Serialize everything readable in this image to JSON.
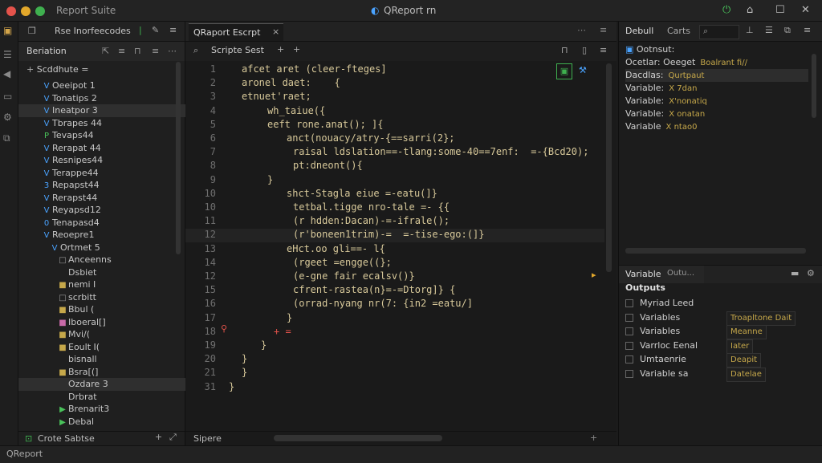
{
  "titlebar": {
    "app_name": "Report Suite",
    "window_title": "QReport rn",
    "dot_colors": [
      "#e5534b",
      "#e3a82b",
      "#3fb04f"
    ]
  },
  "sidebar": {
    "top_label": "Rse Inorfeecodes",
    "section_label": "Beriation",
    "tree_header": "Scddhute =",
    "items": [
      {
        "label": "Oeeipot 1",
        "icon": "V"
      },
      {
        "label": "Tonatips 2",
        "icon": "V"
      },
      {
        "label": "Ineatpor 3",
        "icon": "V"
      },
      {
        "label": "Tbrapes 44",
        "icon": "V"
      },
      {
        "label": "Tevaps44",
        "icon": "P"
      },
      {
        "label": "Rerapat 44",
        "icon": "V"
      },
      {
        "label": "Resnipes44",
        "icon": "V"
      },
      {
        "label": "Terappe44",
        "icon": "V"
      },
      {
        "label": "Repapst44",
        "icon": "3"
      },
      {
        "label": "Rerapst44",
        "icon": "V"
      },
      {
        "label": "Reyapsd12",
        "icon": "V"
      },
      {
        "label": "Tenapasd4",
        "icon": "0"
      },
      {
        "label": "Reoepre1",
        "icon": "V"
      },
      {
        "label": "Ortmet 5",
        "icon": "V"
      },
      {
        "label": "Anceenns",
        "icon": "□"
      },
      {
        "label": "Dsbiet",
        "icon": ""
      },
      {
        "label": "nemi I",
        "icon": "■"
      },
      {
        "label": "scrbitt",
        "icon": "□"
      },
      {
        "label": "Bbul (",
        "icon": "■"
      },
      {
        "label": "Iboeral[]",
        "icon": "■"
      },
      {
        "label": "Mvi/(",
        "icon": "■"
      },
      {
        "label": "Eoult I(",
        "icon": "■"
      },
      {
        "label": "bisnall",
        "icon": ""
      },
      {
        "label": "Bsra[(]",
        "icon": "■"
      },
      {
        "label": "Ozdare 3",
        "icon": ""
      },
      {
        "label": "Drbrat",
        "icon": ""
      },
      {
        "label": "Brenarit3",
        "icon": "▶"
      },
      {
        "label": "Debal",
        "icon": "▶"
      }
    ],
    "footer_label": "Crote Sabtse"
  },
  "editor": {
    "tab_label": "QRaport Escrpt",
    "tab_close": "×",
    "toolbar_label": "Scripte Sest",
    "footer_label": "Sipere",
    "lines": [
      {
        "num": "1",
        "text": "afcet aret (cleer-fteges]",
        "indent": 0
      },
      {
        "num": "2",
        "text": "aronel daet:    {",
        "indent": 0
      },
      {
        "num": "3",
        "text": "etnuet'raet;",
        "indent": 0
      },
      {
        "num": "4",
        "text": "wh_taiue({",
        "indent": 4
      },
      {
        "num": "5",
        "text": "eeft rone.anat(); ]{",
        "indent": 4
      },
      {
        "num": "6",
        "text": "anct(nouacy/atry-{==sarri(2};",
        "indent": 7
      },
      {
        "num": "7",
        "text": "raisal ldslation==-tlang:some-40==7enf:  =-{Bcd20);",
        "indent": 8
      },
      {
        "num": "8",
        "text": "pt:dneont(){",
        "indent": 8
      },
      {
        "num": "9",
        "text": "}",
        "indent": 4
      },
      {
        "num": "10",
        "text": "shct-Stagla eiue =-eatu(]}",
        "indent": 7
      },
      {
        "num": "10",
        "text": "tetbal.tigge nro-tale =- {{",
        "indent": 8
      },
      {
        "num": "11",
        "text": "(r hdden:Dacan)-=-ifrale();",
        "indent": 8
      },
      {
        "num": "12",
        "text": "(r'boneen1trim)-=  =-tise-ego:(]}",
        "indent": 8
      },
      {
        "num": "13",
        "text": "eHct.oo gli==- l{",
        "indent": 7
      },
      {
        "num": "14",
        "text": "(rgeet =engge((};",
        "indent": 8
      },
      {
        "num": "12",
        "text": "(e-gne fair ecalsv()}",
        "indent": 8
      },
      {
        "num": "15",
        "text": "cfrent-rastea(n}=-=Dtorg]} {",
        "indent": 8
      },
      {
        "num": "16",
        "text": "(orrad-nyang nr(7: {in2 =eatu/]",
        "indent": 8
      },
      {
        "num": "17",
        "text": "}",
        "indent": 7
      },
      {
        "num": "18",
        "text": "+ =",
        "indent": 5
      },
      {
        "num": "19",
        "text": "}",
        "indent": 3
      },
      {
        "num": "20",
        "text": "}",
        "indent": 0
      },
      {
        "num": "21",
        "text": "}",
        "indent": 0
      },
      {
        "num": "31",
        "text": "}",
        "indent": -2
      }
    ]
  },
  "rightpanel": {
    "tab_debug": "Debull",
    "tab_caret": "Carts",
    "output_header": "Ootnsut:",
    "debug_rows": [
      {
        "label": "Ocetlar: Oeeget",
        "value": "Boalrant fi//"
      },
      {
        "label": "Dacdlas:",
        "value": "Qurtpaut"
      },
      {
        "label": "Variable:",
        "value": "X 7dan"
      },
      {
        "label": "Variable:",
        "value": "X'nonatiq"
      },
      {
        "label": "Variable:",
        "value": "X onatan"
      },
      {
        "label": "Variable",
        "value": "X ntao0"
      }
    ],
    "variables_tab": "Variable",
    "variables_tab2": "Outu...",
    "outputs_title": "Outputs",
    "output_rows": [
      {
        "label": "Myriad Leed",
        "chip": ""
      },
      {
        "label": "Variables",
        "chip": "Troapltone Dait"
      },
      {
        "label": "Variables",
        "chip": "Meanne"
      },
      {
        "label": "Varrloc Eenal",
        "chip": "Iater"
      },
      {
        "label": "Umtaenrie",
        "chip": "Deapit"
      },
      {
        "label": "Variable sa",
        "chip": "Datelae"
      }
    ]
  },
  "statusbar": {
    "label": "QReport"
  }
}
